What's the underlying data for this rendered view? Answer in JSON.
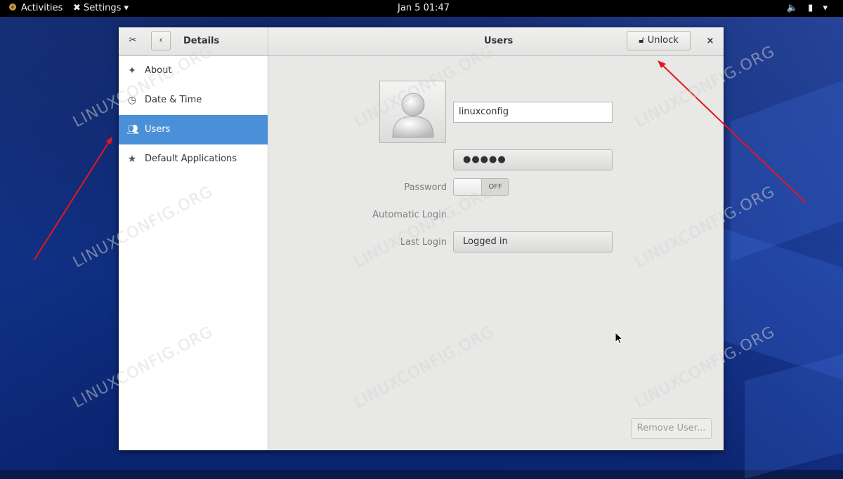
{
  "topbar": {
    "activities": "Activities",
    "app_menu": "Settings",
    "clock": "Jan 5  01:47"
  },
  "window": {
    "sidebar_title": "Details",
    "title": "Users",
    "unlock_label": "Unlock",
    "close_label": "×"
  },
  "sidebar": {
    "items": [
      {
        "label": "About",
        "icon": "sparkle-icon"
      },
      {
        "label": "Date & Time",
        "icon": "clock-icon"
      },
      {
        "label": "Users",
        "icon": "users-icon",
        "active": true
      },
      {
        "label": "Default Applications",
        "icon": "star-icon"
      }
    ]
  },
  "user": {
    "username": "linuxconfig",
    "password_label": "Password",
    "password_value": "●●●●●",
    "autologin_label": "Automatic Login",
    "autologin_state": "OFF",
    "last_login_label": "Last Login",
    "last_login_value": "Logged in",
    "remove_label": "Remove User..."
  },
  "watermark": "LINUXCONFIG.ORG",
  "colors": {
    "accent": "#4a90d9",
    "annotation_arrow": "#e8141e"
  }
}
